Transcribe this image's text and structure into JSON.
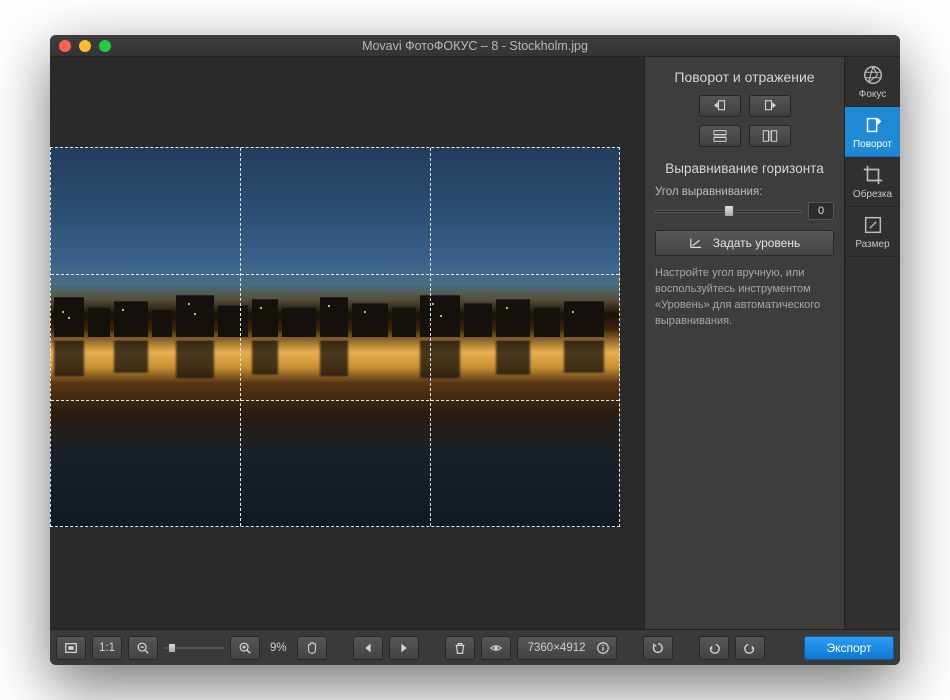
{
  "window": {
    "title": "Movavi ФотоФОКУС – 8 - Stockholm.jpg"
  },
  "panel": {
    "rotate_heading": "Поворот и отражение",
    "straighten_heading": "Выравнивание горизонта",
    "angle_label": "Угол выравнивания:",
    "angle_value": "0",
    "level_button": "Задать уровень",
    "help_text": "Настройте угол вручную, или воспользуйтесь инструментом «Уровень» для автоматического выравнивания."
  },
  "tools": {
    "focus": "Фокус",
    "rotate": "Поворот",
    "crop": "Обрезка",
    "resize": "Размер"
  },
  "bottombar": {
    "fit_label": "1:1",
    "zoom_percent": "9%",
    "dimensions": "7360×4912",
    "export": "Экспорт"
  }
}
